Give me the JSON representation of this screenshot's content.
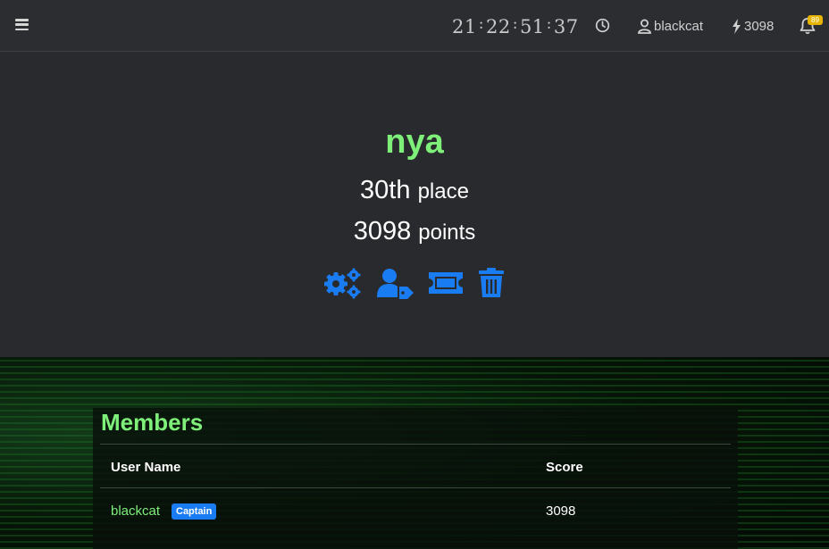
{
  "nav": {
    "clock": {
      "hours": "21",
      "minutes": "22",
      "seconds": "51",
      "frames": "37",
      "separator": ":"
    },
    "user": "blackcat",
    "points": "3098",
    "notification_count": "89"
  },
  "team": {
    "name": "nya",
    "place_value": "30th",
    "place_label": "place",
    "points_value": "3098",
    "points_label": "points",
    "actions": [
      "settings-icon",
      "user-tag-icon",
      "ticket-icon",
      "trash-icon"
    ]
  },
  "members": {
    "title": "Members",
    "columns": [
      "User Name",
      "Score"
    ],
    "rows": [
      {
        "name": "blackcat",
        "badge": "Captain",
        "score": "3098"
      }
    ]
  },
  "colors": {
    "accent_green": "#7ef07a",
    "action_blue": "#1a7cf2",
    "badge_yellow": "#e6b400"
  }
}
